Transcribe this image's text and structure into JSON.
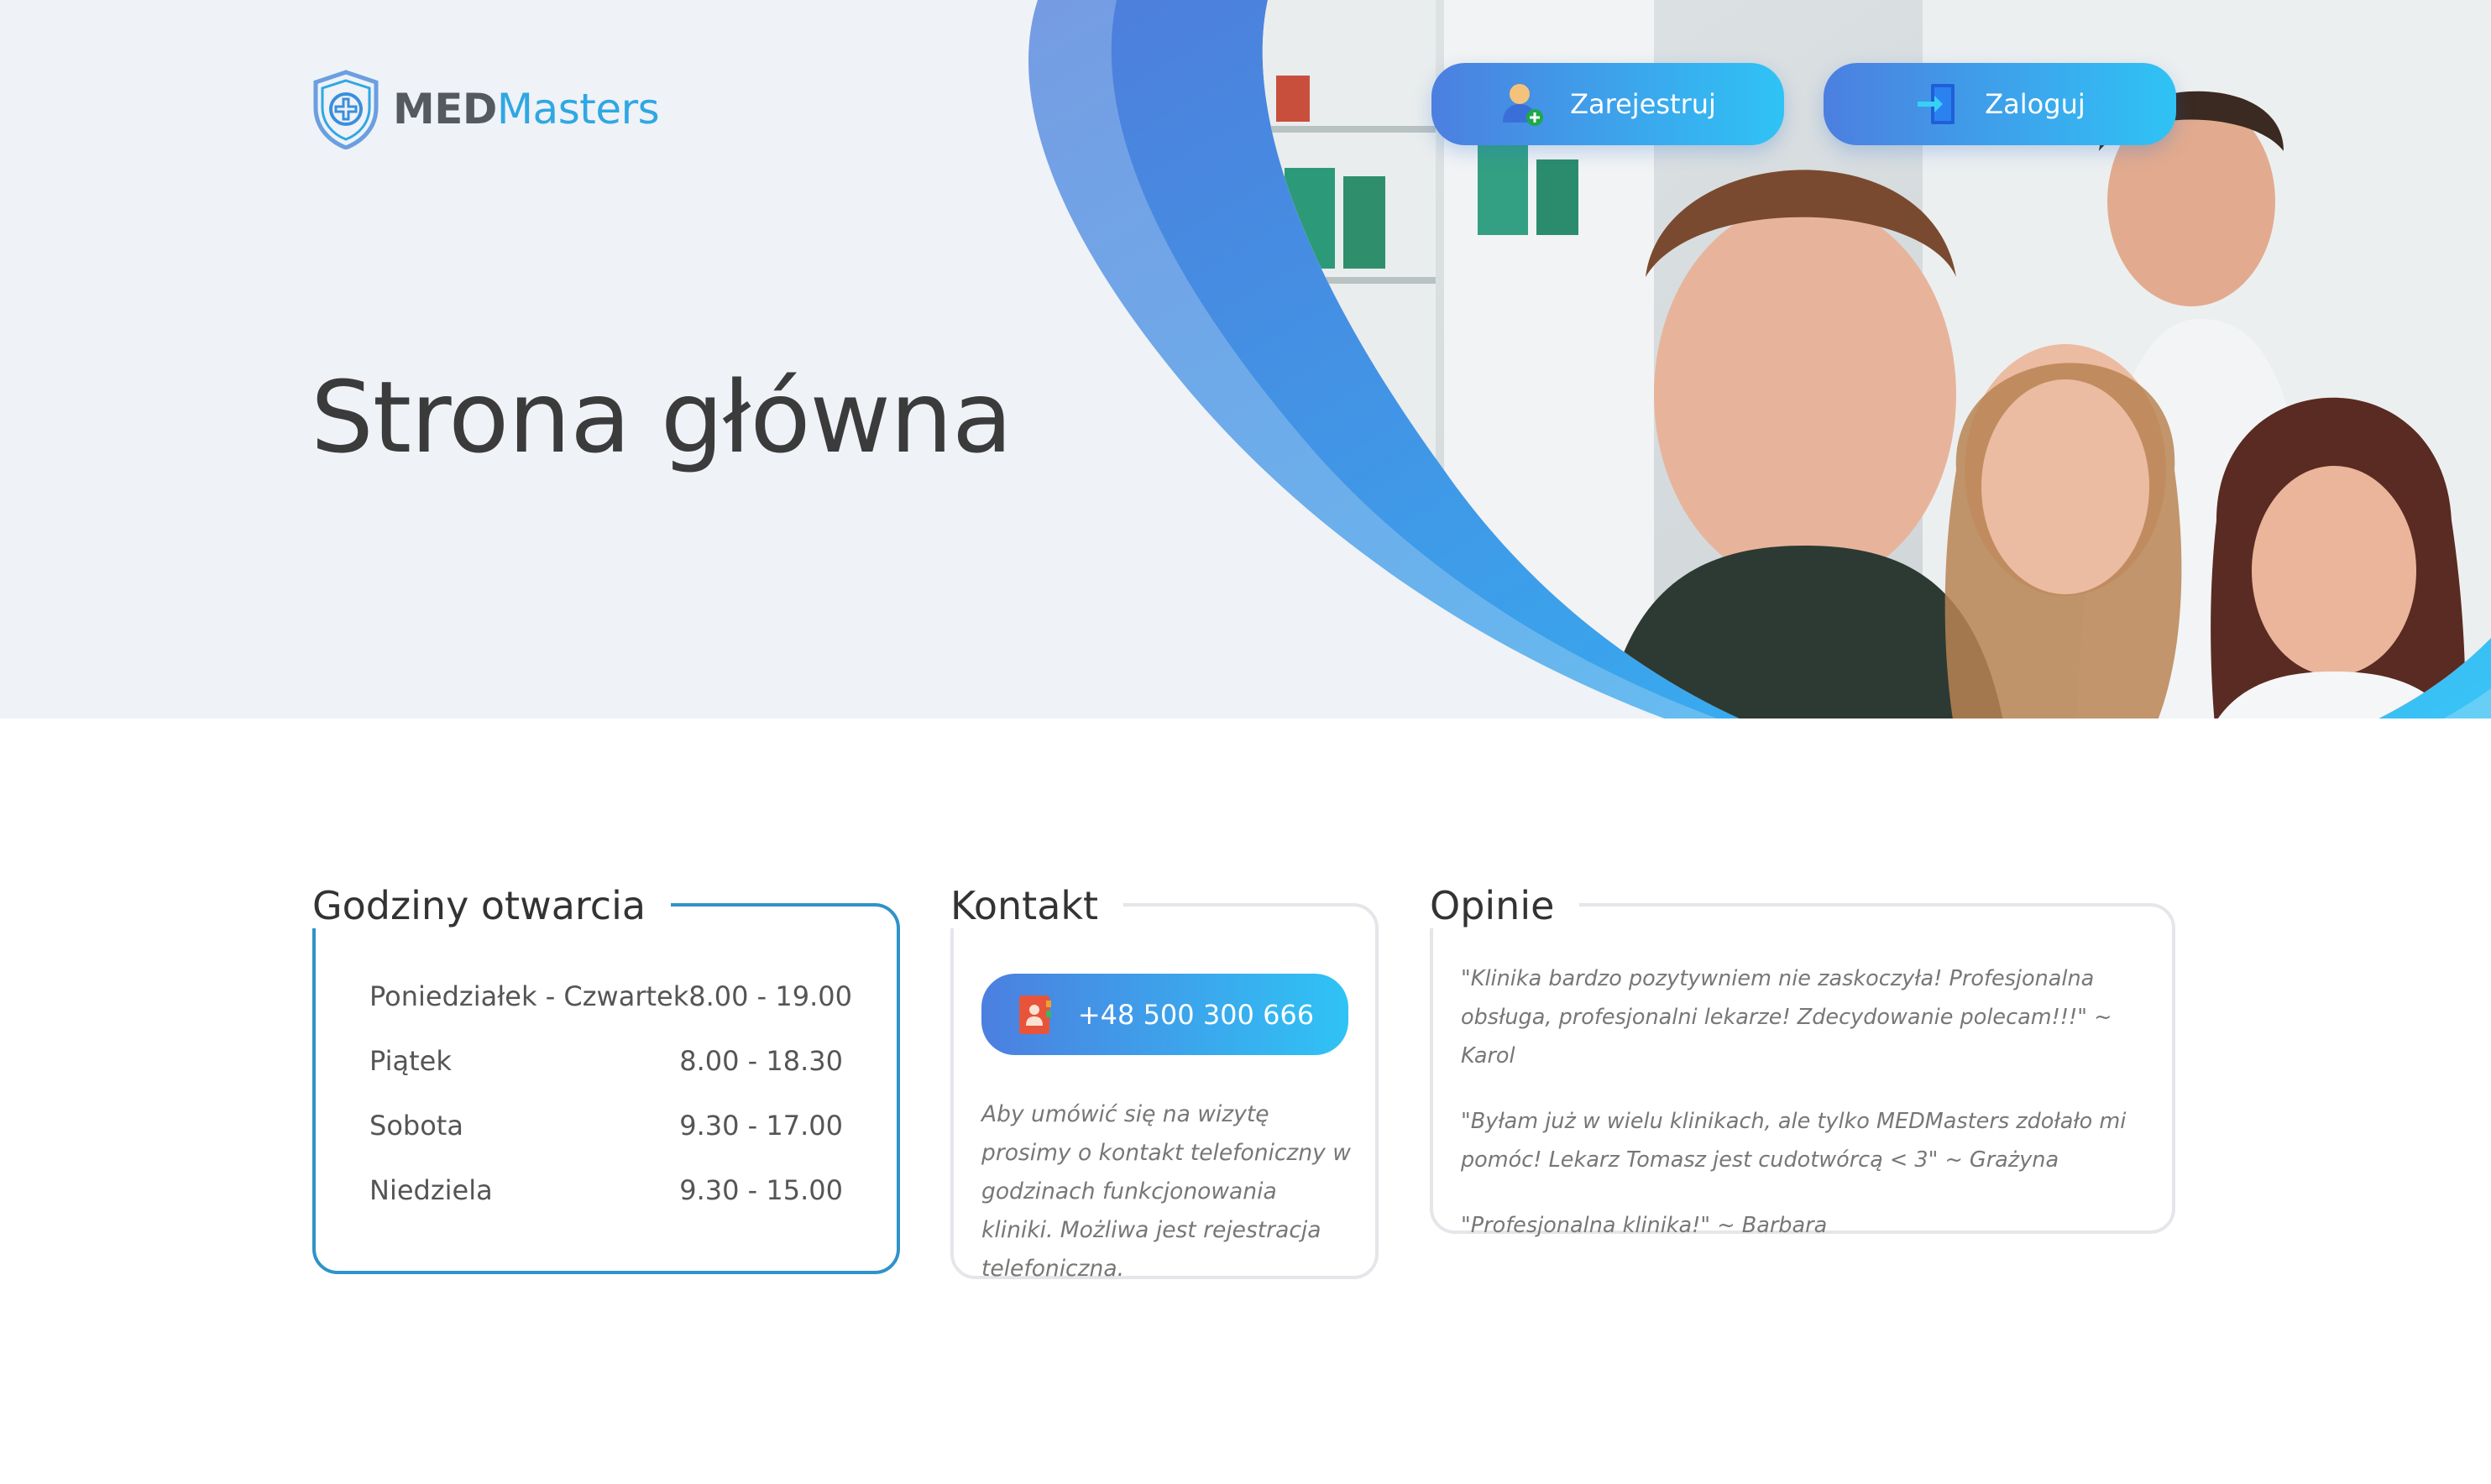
{
  "brand": {
    "name_bold": "MED",
    "name_light": "Masters",
    "brand_color": "#2fa7e3"
  },
  "header": {
    "register_label": "Zarejestruj",
    "login_label": "Zaloguj",
    "register_icon": "add-user-icon",
    "login_icon": "login-icon"
  },
  "hero": {
    "title": "Strona główna",
    "photo": "clinic-staff-photo"
  },
  "hours": {
    "title": "Godziny otwarcia",
    "rows": [
      {
        "day": "Poniedziałek - Czwartek",
        "time": "8.00 - 19.00"
      },
      {
        "day": "Piątek",
        "time": "8.00 - 18.30"
      },
      {
        "day": "Sobota",
        "time": "9.30 - 17.00"
      },
      {
        "day": "Niedziela",
        "time": "9.30 - 15.00"
      }
    ]
  },
  "contact": {
    "title": "Kontakt",
    "phone": "+48 500 300 666",
    "phone_icon": "contact-book-icon",
    "note": "Aby umówić się na wizytę prosimy o kontakt telefoniczny w godzinach funkcjonowania kliniki. Możliwa jest rejestracja telefoniczna."
  },
  "reviews": {
    "title": "Opinie",
    "items": [
      "\"Klinika bardzo pozytywniem nie zaskoczyła! Profesjonalna obsługa, profesjonalni lekarze! Zdecydowanie polecam!!!\" ~ Karol",
      "\"Byłam już w wielu klinikach, ale tylko MEDMasters zdołało mi pomóc! Lekarz Tomasz jest cudotwórcą < 3\" ~ Grażyna",
      "\"Profesjonalna klinika!\" ~ Barbara"
    ]
  },
  "colors": {
    "accent_gradient_start": "#4c7fe0",
    "accent_gradient_end": "#2fc3f5",
    "hero_background": "#eff2f7",
    "hours_border": "#2f93c9"
  }
}
